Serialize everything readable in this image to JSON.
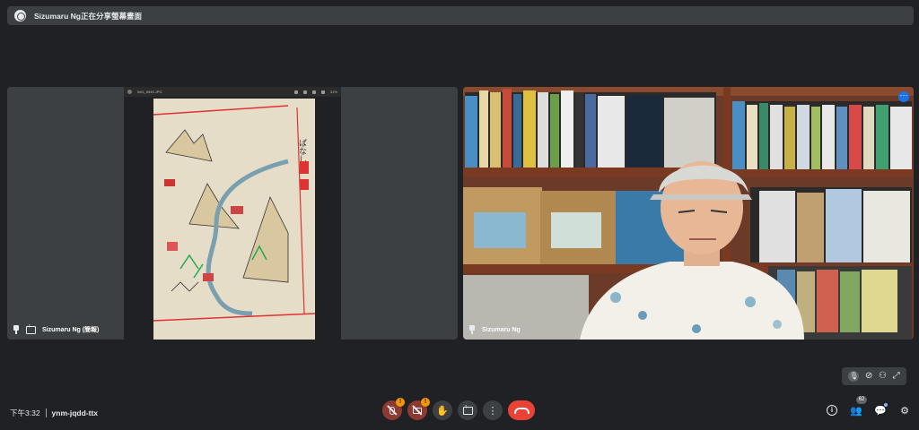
{
  "banner": {
    "text": "Sizumaru Ng正在分享螢幕畫面"
  },
  "tiles": [
    {
      "name": "Sizumaru Ng (簡報)",
      "shared_window": {
        "title": "IMG_8945.JPG",
        "zoom": "31%"
      },
      "page_text": "ぱなし"
    },
    {
      "name": "Sizumaru Ng"
    }
  ],
  "pip": {
    "icons": [
      "mic-off-icon",
      "camera-off-icon",
      "self-view-icon",
      "expand-icon"
    ]
  },
  "bottom": {
    "time": "下午3:32",
    "meeting_code": "ynm-jqdd-ttx",
    "mic_badge": "!",
    "cam_badge": "!",
    "people_count": "62"
  },
  "colors": {
    "end_call": "#ea4335",
    "badge": "#f29900",
    "accent": "#1a73e8",
    "bg": "#202124",
    "tile": "#3c4043"
  }
}
